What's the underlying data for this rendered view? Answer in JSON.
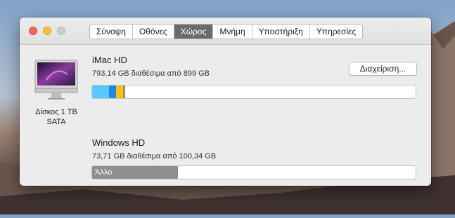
{
  "window": {
    "tabs": [
      {
        "label": "Σύνοψη",
        "active": false
      },
      {
        "label": "Οθόνες",
        "active": false
      },
      {
        "label": "Χώρος",
        "active": true
      },
      {
        "label": "Μνήμη",
        "active": false
      },
      {
        "label": "Υποστήριξη",
        "active": false
      },
      {
        "label": "Υπηρεσίες",
        "active": false
      }
    ]
  },
  "disk": {
    "icon": "imac-icon",
    "label_line1": "Δίσκος 1 TB",
    "label_line2": "SATA"
  },
  "volumes": [
    {
      "name": "iMac HD",
      "info": "793,14 GB διαθέσιμα από 899 GB",
      "usage_segments": [
        {
          "category": "apps",
          "color": "#5ac8fa",
          "fraction": 0.053
        },
        {
          "category": "documents",
          "color": "#1e88e5",
          "fraction": 0.021
        },
        {
          "category": "photos",
          "color": "#ffc107",
          "fraction": 0.021
        },
        {
          "category": "system",
          "color": "#8e8e8e",
          "fraction": 0.008
        }
      ]
    },
    {
      "name": "Windows HD",
      "info": "73,71 GB διαθέσιμα από 100,34 GB",
      "usage_segments": [
        {
          "category": "other",
          "label": "Άλλο",
          "color": "#8e8e8e",
          "fraction": 0.265
        }
      ]
    }
  ],
  "manage_button": {
    "label": "Διαχείριση..."
  }
}
